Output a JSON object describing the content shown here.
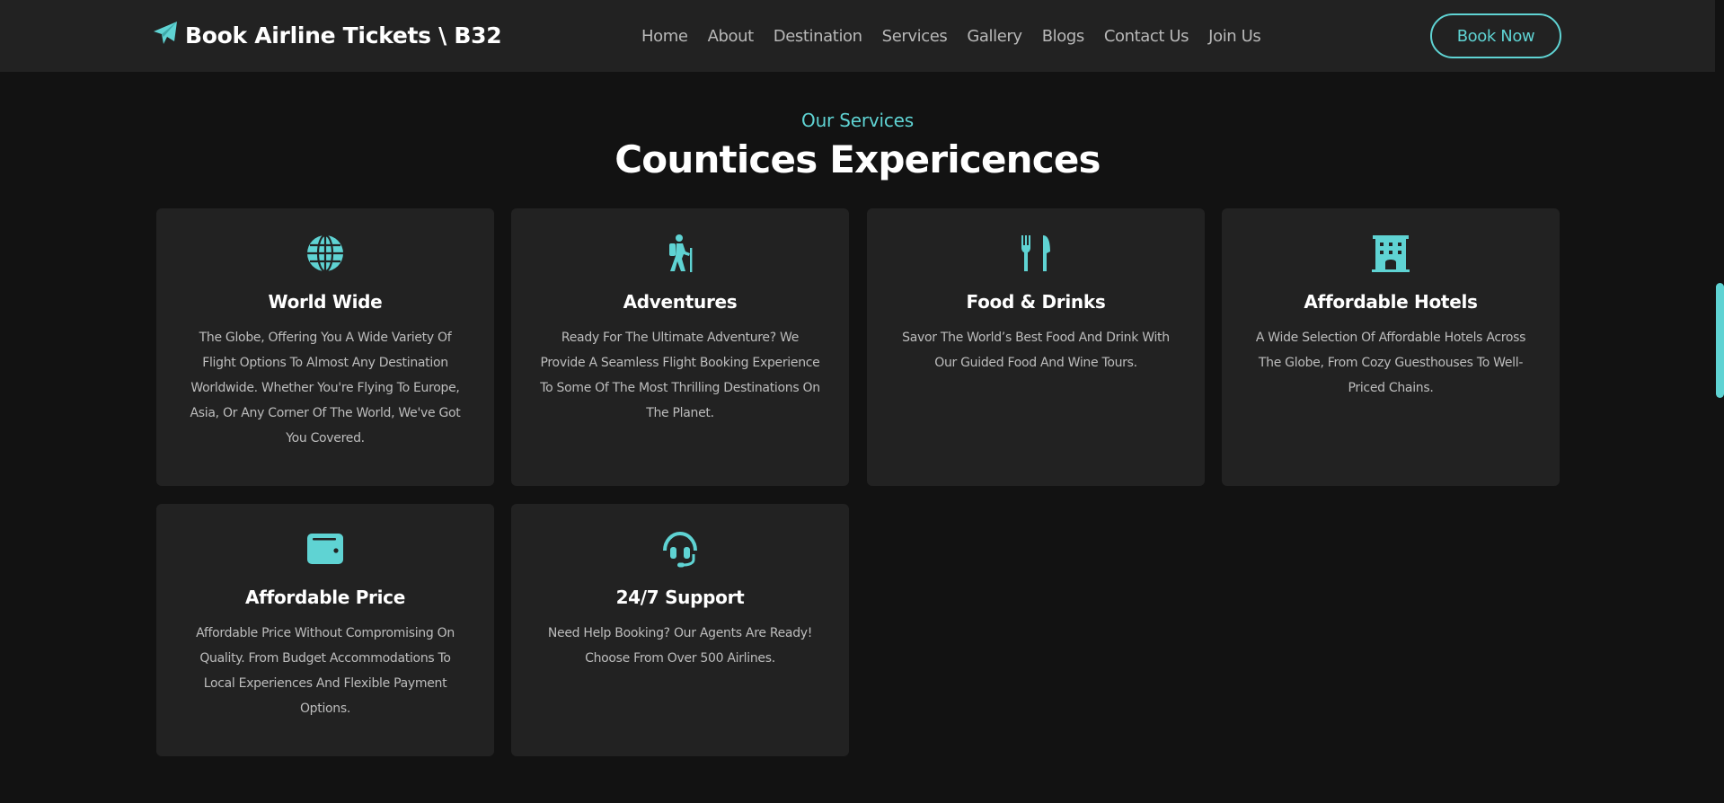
{
  "brand": {
    "name": "Book Airline Tickets \\ B32",
    "icon": "paper-plane-icon"
  },
  "nav": {
    "items": [
      "Home",
      "About",
      "Destination",
      "Services",
      "Gallery",
      "Blogs",
      "Contact Us",
      "Join Us"
    ],
    "cta": "Book Now"
  },
  "section": {
    "subtitle": "Our Services",
    "title": "Countices Expericences"
  },
  "colors": {
    "accent": "#5fd3d3",
    "background": "#121212",
    "card": "#222222",
    "header": "#222222"
  },
  "services": [
    {
      "icon": "globe-icon",
      "title": "World Wide",
      "description": "The Globe, Offering You A Wide Variety Of Flight Options To Almost Any Destination Worldwide. Whether You're Flying To Europe, Asia, Or Any Corner Of The World, We've Got You Covered."
    },
    {
      "icon": "hiker-icon",
      "title": "Adventures",
      "description": "Ready For The Ultimate Adventure? We Provide A Seamless Flight Booking Experience To Some Of The Most Thrilling Destinations On The Planet."
    },
    {
      "icon": "utensils-icon",
      "title": "Food & Drinks",
      "description": "Savor The World’s Best Food And Drink With Our Guided Food And Wine Tours."
    },
    {
      "icon": "hotel-icon",
      "title": "Affordable Hotels",
      "description": "A Wide Selection Of Affordable Hotels Across The Globe, From Cozy Guesthouses To Well-Priced Chains."
    },
    {
      "icon": "wallet-icon",
      "title": "Affordable Price",
      "description": "Affordable Price Without Compromising On Quality. From Budget Accommodations To Local Experiences And Flexible Payment Options."
    },
    {
      "icon": "headset-icon",
      "title": "24/7 Support",
      "description": "Need Help Booking? Our Agents Are Ready! Choose From Over 500 Airlines."
    }
  ]
}
